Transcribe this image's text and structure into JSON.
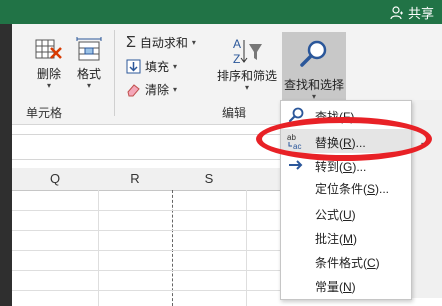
{
  "titlebar": {
    "share_label": "共享"
  },
  "ribbon": {
    "cells_group": {
      "label": "单元格",
      "delete_label": "删除",
      "format_label": "格式"
    },
    "edit_group": {
      "label": "编辑",
      "autosum_label": "自动求和",
      "fill_label": "填充",
      "clear_label": "清除",
      "sort_filter_label": "排序和筛选",
      "find_select_label": "查找和选择"
    }
  },
  "grid": {
    "columns": [
      "Q",
      "R",
      "S",
      "T"
    ]
  },
  "menu": {
    "items": [
      {
        "label": "查找(F)...",
        "base": "查找(",
        "key": "F",
        "tail": ")..."
      },
      {
        "label": "替换(R)...",
        "base": "替换(",
        "key": "R",
        "tail": ")..."
      },
      {
        "label": "转到(G)...",
        "base": "转到(",
        "key": "G",
        "tail": ")..."
      },
      {
        "label": "定位条件(S)...",
        "base": "定位条件(",
        "key": "S",
        "tail": ")..."
      },
      {
        "label": "公式(U)",
        "base": "公式(",
        "key": "U",
        "tail": ")"
      },
      {
        "label": "批注(M)",
        "base": "批注(",
        "key": "M",
        "tail": ")"
      },
      {
        "label": "条件格式(C)",
        "base": "条件格式(",
        "key": "C",
        "tail": ")"
      },
      {
        "label": "常量(N)",
        "base": "常量(",
        "key": "N",
        "tail": ")"
      }
    ]
  },
  "colors": {
    "titlebar": "#217346",
    "highlight_oval": "#e82126",
    "accent_blue": "#2b579a"
  }
}
